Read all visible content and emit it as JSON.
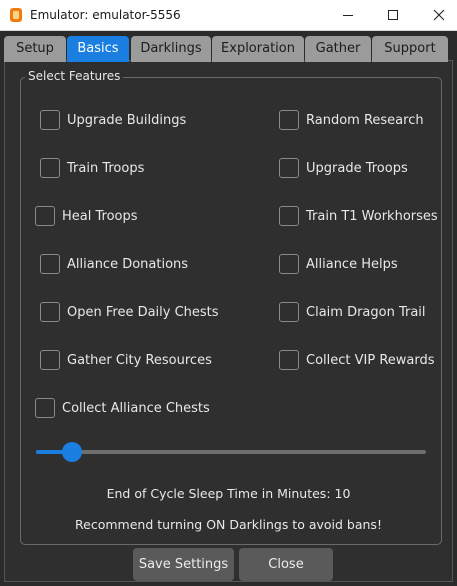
{
  "window": {
    "title": "Emulator: emulator-5556",
    "minimize_glyph": "—",
    "maximize_glyph": "☐",
    "close_glyph": "✕"
  },
  "tabs": [
    {
      "label": "Setup",
      "active": false
    },
    {
      "label": "Basics",
      "active": true
    },
    {
      "label": "Darklings",
      "active": false
    },
    {
      "label": "Exploration",
      "active": false
    },
    {
      "label": "Gather",
      "active": false
    },
    {
      "label": "Support",
      "active": false
    }
  ],
  "group": {
    "title": "Select Features"
  },
  "features": {
    "upgrade_buildings": {
      "label": "Upgrade Buildings",
      "checked": false
    },
    "random_research": {
      "label": "Random Research",
      "checked": false
    },
    "train_troops": {
      "label": "Train Troops",
      "checked": false
    },
    "upgrade_troops": {
      "label": "Upgrade Troops",
      "checked": false
    },
    "heal_troops": {
      "label": "Heal Troops",
      "checked": false
    },
    "train_t1_workhorses": {
      "label": "Train T1 Workhorses",
      "checked": false
    },
    "alliance_donations": {
      "label": "Alliance Donations",
      "checked": false
    },
    "alliance_helps": {
      "label": "Alliance Helps",
      "checked": false
    },
    "open_free_daily_chests": {
      "label": "Open Free Daily Chests",
      "checked": false
    },
    "claim_dragon_trail": {
      "label": "Claim Dragon Trail",
      "checked": false
    },
    "gather_city_resources": {
      "label": "Gather City Resources",
      "checked": false
    },
    "collect_vip_rewards": {
      "label": "Collect VIP Rewards",
      "checked": false
    },
    "collect_alliance_chests": {
      "label": "Collect Alliance Chests",
      "checked": false
    }
  },
  "sleep": {
    "label": "End of Cycle Sleep Time in Minutes: 10",
    "value_minutes": 10
  },
  "recommendation": "Recommend turning ON Darklings to avoid bans!",
  "buttons": {
    "save": "Save Settings",
    "close": "Close"
  },
  "colors": {
    "accent": "#1a7fe0",
    "background": "#2b2b2b",
    "tab_inactive": "#9b9b9b"
  },
  "icons": {
    "app": "emulator-app-icon"
  }
}
